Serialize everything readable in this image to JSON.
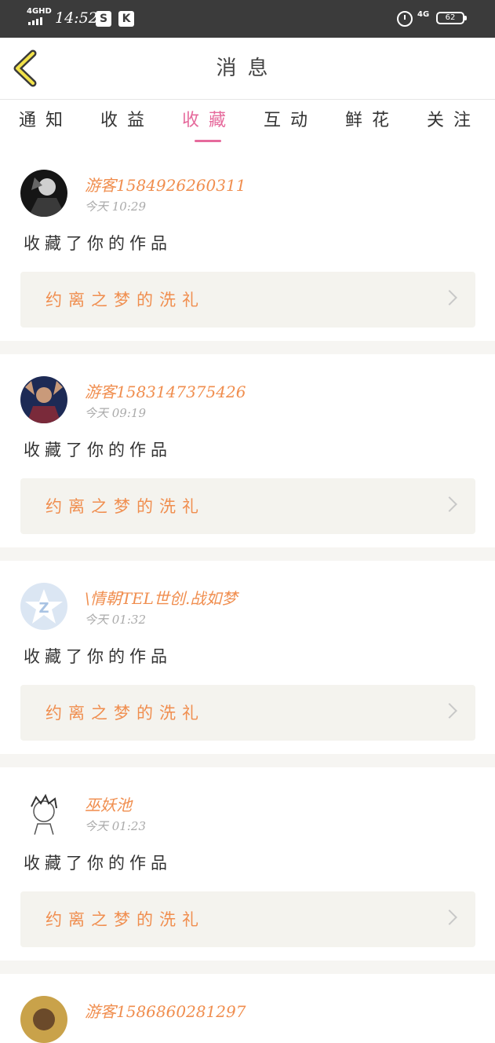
{
  "status_bar": {
    "network": "4GHD",
    "time": "14:52",
    "app_icons": [
      "S",
      "K"
    ],
    "cell": "4G",
    "battery": "62"
  },
  "header": {
    "title": "消息",
    "back_icon": "chevron-left-icon"
  },
  "tabs": [
    {
      "label": "通知",
      "active": false
    },
    {
      "label": "收益",
      "active": false
    },
    {
      "label": "收藏",
      "active": true
    },
    {
      "label": "互动",
      "active": false
    },
    {
      "label": "鲜花",
      "active": false
    },
    {
      "label": "关注",
      "active": false
    }
  ],
  "accent_color": "#e66a9c",
  "name_color": "#f08e4f",
  "notifications": [
    {
      "user": "游客1584926260311",
      "time": "今天 10:29",
      "action": "收藏了你的作品",
      "work": "约离之梦的洗礼"
    },
    {
      "user": "游客1583147375426",
      "time": "今天 09:19",
      "action": "收藏了你的作品",
      "work": "约离之梦的洗礼"
    },
    {
      "user": "\\情朝TEL世创.战如梦",
      "time": "今天 01:32",
      "action": "收藏了你的作品",
      "work": "约离之梦的洗礼"
    },
    {
      "user": "巫妖池",
      "time": "今天 01:23",
      "action": "收藏了你的作品",
      "work": "约离之梦的洗礼"
    },
    {
      "user": "游客1586860281297",
      "time": "",
      "action": "",
      "work": ""
    }
  ]
}
